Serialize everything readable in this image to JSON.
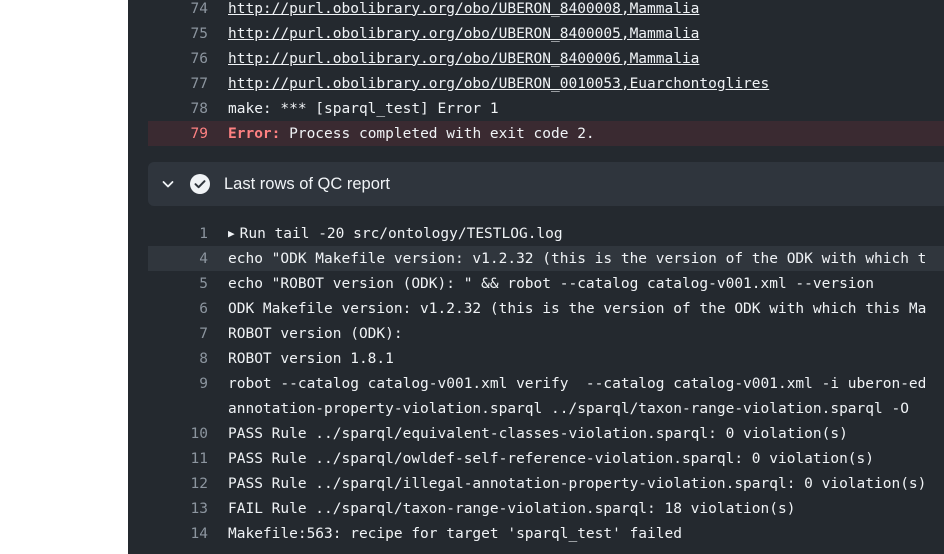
{
  "top_lines": [
    {
      "num": "74",
      "url": "http://purl.obolibrary.org/obo/UBERON_8400008,Mammalia"
    },
    {
      "num": "75",
      "url": "http://purl.obolibrary.org/obo/UBERON_8400005,Mammalia"
    },
    {
      "num": "76",
      "url": "http://purl.obolibrary.org/obo/UBERON_8400006,Mammalia"
    },
    {
      "num": "77",
      "url": "http://purl.obolibrary.org/obo/UBERON_0010053,Euarchontoglires"
    },
    {
      "num": "78",
      "text": "make: *** [sparql_test] Error 1"
    },
    {
      "num": "79",
      "prefix": "Error:",
      "text": " Process completed with exit code 2."
    }
  ],
  "step": {
    "title": "Last rows of QC report",
    "chevron_icon": "chevron-down-icon",
    "status_icon": "check-circle-icon"
  },
  "step_lines": [
    {
      "num": "1",
      "text": "Run tail -20 src/ontology/TESTLOG.log"
    },
    {
      "num": "4",
      "text": "echo \"ODK Makefile version: v1.2.32 (this is the version of the ODK with which t"
    },
    {
      "num": "5",
      "text": "echo \"ROBOT version (ODK): \" && robot --catalog catalog-v001.xml --version"
    },
    {
      "num": "6",
      "text": "ODK Makefile version: v1.2.32 (this is the version of the ODK with which this Ma"
    },
    {
      "num": "7",
      "text": "ROBOT version (ODK):"
    },
    {
      "num": "8",
      "text": "ROBOT version 1.8.1"
    },
    {
      "num": "9",
      "text": "robot --catalog catalog-v001.xml verify  --catalog catalog-v001.xml -i uberon-ed"
    },
    {
      "num": "",
      "text": "annotation-property-violation.sparql ../sparql/taxon-range-violation.sparql -O"
    },
    {
      "num": "10",
      "text": "PASS Rule ../sparql/equivalent-classes-violation.sparql: 0 violation(s)"
    },
    {
      "num": "11",
      "text": "PASS Rule ../sparql/owldef-self-reference-violation.sparql: 0 violation(s)"
    },
    {
      "num": "12",
      "text": "PASS Rule ../sparql/illegal-annotation-property-violation.sparql: 0 violation(s)"
    },
    {
      "num": "13",
      "text": "FAIL Rule ../sparql/taxon-range-violation.sparql: 18 violation(s)"
    },
    {
      "num": "14",
      "text": "Makefile:563: recipe for target 'sparql_test' failed"
    }
  ],
  "colors": {
    "log_background": "#24292f",
    "error_text": "#ff8182",
    "text": "#f0f3f6",
    "line_number": "#8c959f"
  }
}
